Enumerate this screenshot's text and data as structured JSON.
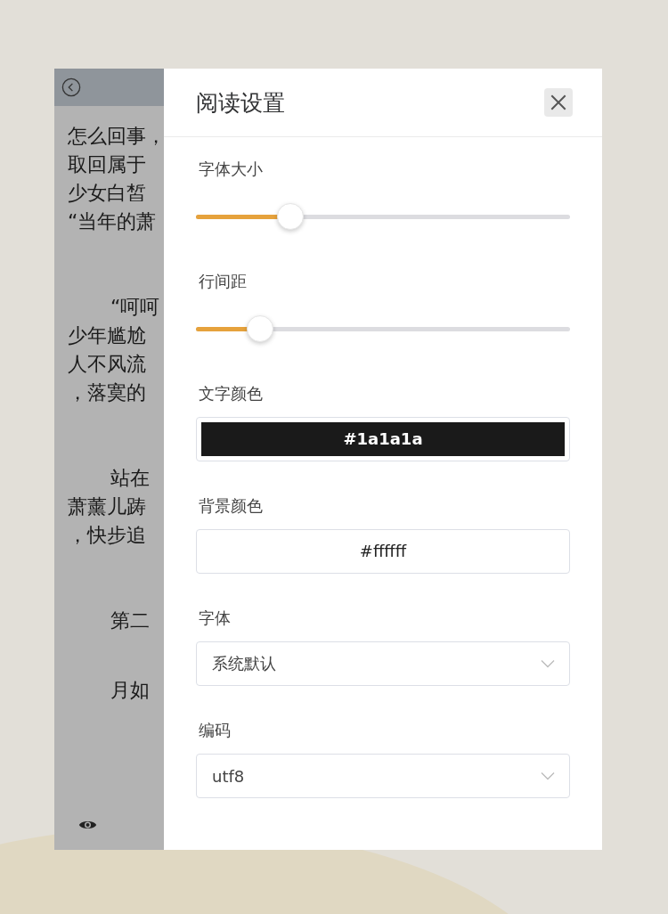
{
  "reader": {
    "paragraphs": [
      {
        "kind": "text",
        "lines": [
          "怎么回事，",
          "取回属于",
          "少女白皙",
          "“当年的萧"
        ]
      },
      {
        "kind": "indented",
        "lines": [
          "“呵呵",
          "少年尴尬",
          "人不风流",
          "，落寞的"
        ]
      },
      {
        "kind": "indented",
        "lines": [
          "站在",
          "萧薰儿踌",
          "，快步追"
        ]
      },
      {
        "kind": "heading",
        "lines": [
          "第二"
        ]
      },
      {
        "kind": "indented",
        "lines": [
          "月如"
        ]
      }
    ]
  },
  "settings": {
    "title": "阅读设置",
    "items": [
      {
        "kind": "slider",
        "label": "字体大小",
        "level": 0.25
      },
      {
        "kind": "slider",
        "label": "行间距",
        "level": 0.17
      },
      {
        "kind": "color",
        "label": "文字颜色",
        "value": "#1a1a1a"
      },
      {
        "kind": "color",
        "label": "背景颜色",
        "value": "#ffffff"
      },
      {
        "kind": "select",
        "label": "字体",
        "value": "系统默认"
      },
      {
        "kind": "select",
        "label": "编码",
        "value": "utf8"
      }
    ]
  }
}
